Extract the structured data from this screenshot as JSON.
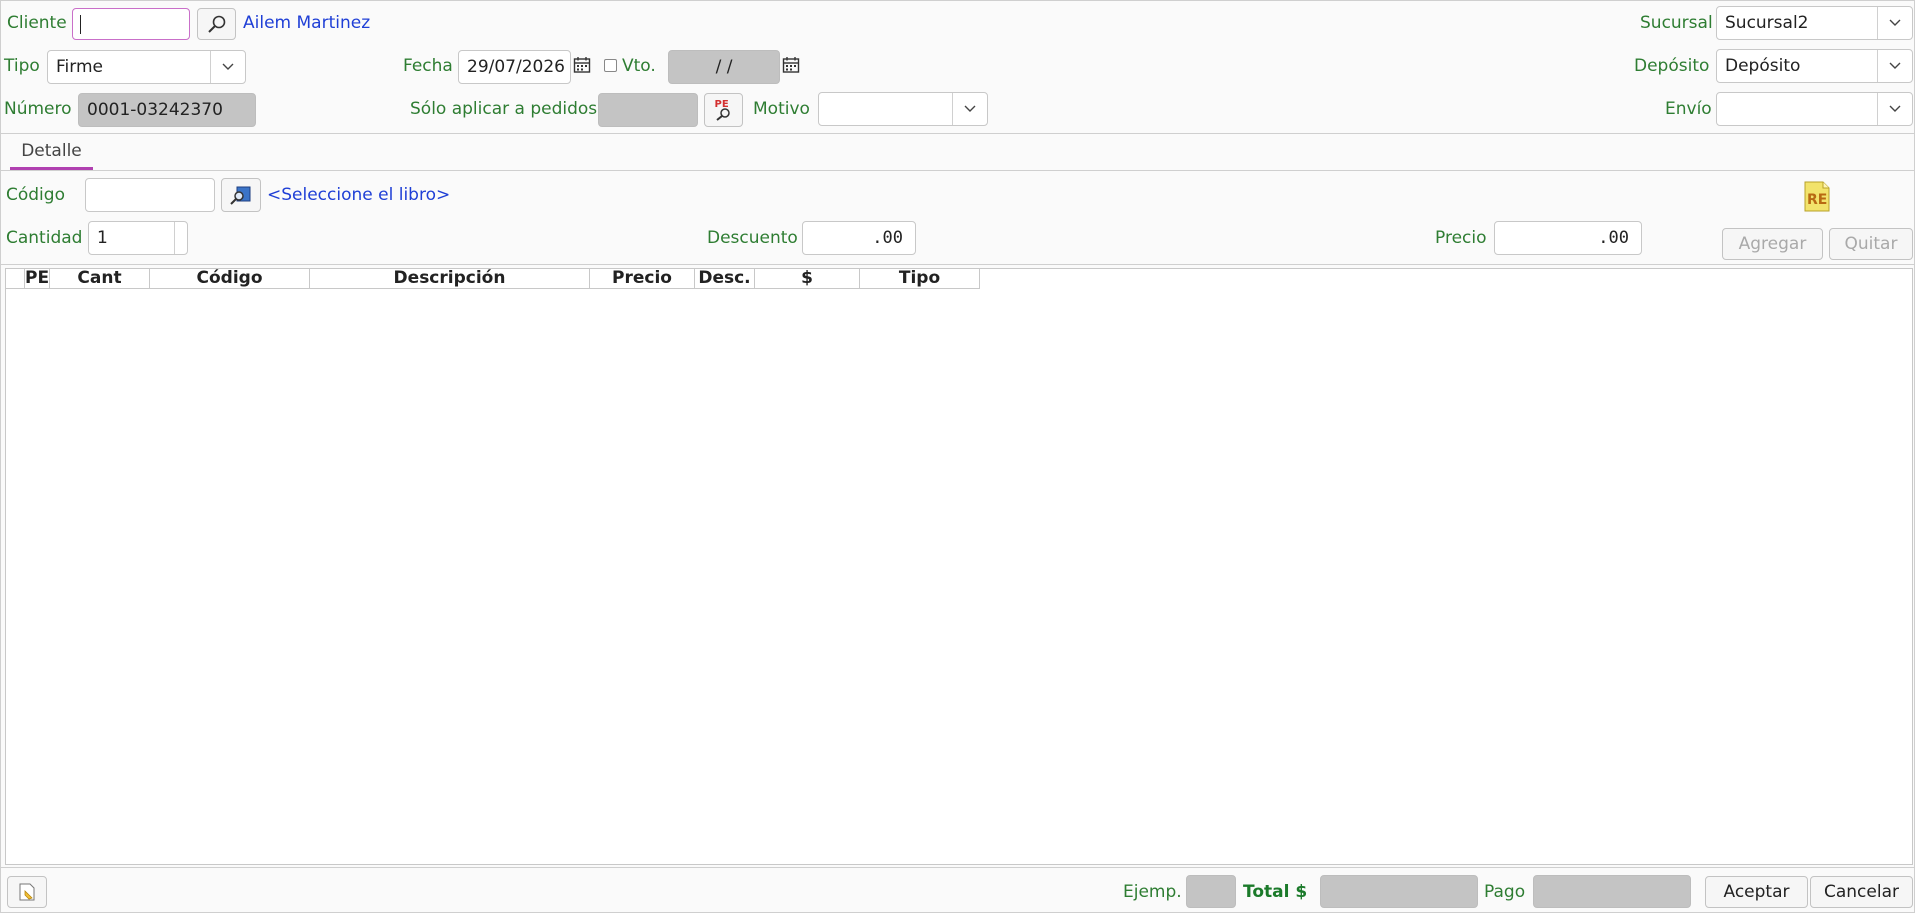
{
  "header": {
    "cliente_label": "Cliente",
    "cliente_value": "",
    "cliente_name": "Ailem Martinez",
    "sucursal_label": "Sucursal",
    "sucursal_value": "Sucursal2",
    "tipo_label": "Tipo",
    "tipo_value": "Firme",
    "fecha_label": "Fecha",
    "fecha_value": "29/07/2026",
    "vto_label": "Vto.",
    "vto_value": "/ /",
    "deposito_label": "Depósito",
    "deposito_value": "Depósito",
    "numero_label": "Número",
    "numero_value": "0001-03242370",
    "solo_pedidos_label": "Sólo aplicar a pedidos",
    "solo_pedidos_value": "",
    "pe_badge": "PE",
    "motivo_label": "Motivo",
    "motivo_value": "",
    "envio_label": "Envío",
    "envio_value": ""
  },
  "tabs": [
    {
      "label": "Detalle"
    }
  ],
  "detail": {
    "codigo_label": "Código",
    "codigo_value": "",
    "libro_link": "<Seleccione el libro>",
    "cantidad_label": "Cantidad",
    "cantidad_value": "1",
    "descuento_label": "Descuento",
    "descuento_value": ".00",
    "precio_label": "Precio",
    "precio_value": ".00",
    "re_badge": "RE",
    "agregar_label": "Agregar",
    "quitar_label": "Quitar"
  },
  "grid": {
    "columns": [
      "PE",
      "Cant",
      "Código",
      "Descripción",
      "Precio",
      "Desc.",
      "$",
      "Tipo"
    ],
    "rows": []
  },
  "footer": {
    "ejemp_label": "Ejemp.",
    "ejemp_value": "",
    "total_label": "Total $",
    "total_value": "",
    "pago_label": "Pago",
    "pago_value": "",
    "aceptar_label": "Aceptar",
    "cancelar_label": "Cancelar"
  },
  "colors": {
    "label_green": "#2e7d32",
    "link_blue": "#1f3fd6",
    "tab_accent": "#b040b0",
    "focus_border": "#c96fc9"
  },
  "icons": [
    "search-icon",
    "calendar-icon",
    "chevron-down-icon",
    "book-search-icon",
    "new-document-icon"
  ]
}
